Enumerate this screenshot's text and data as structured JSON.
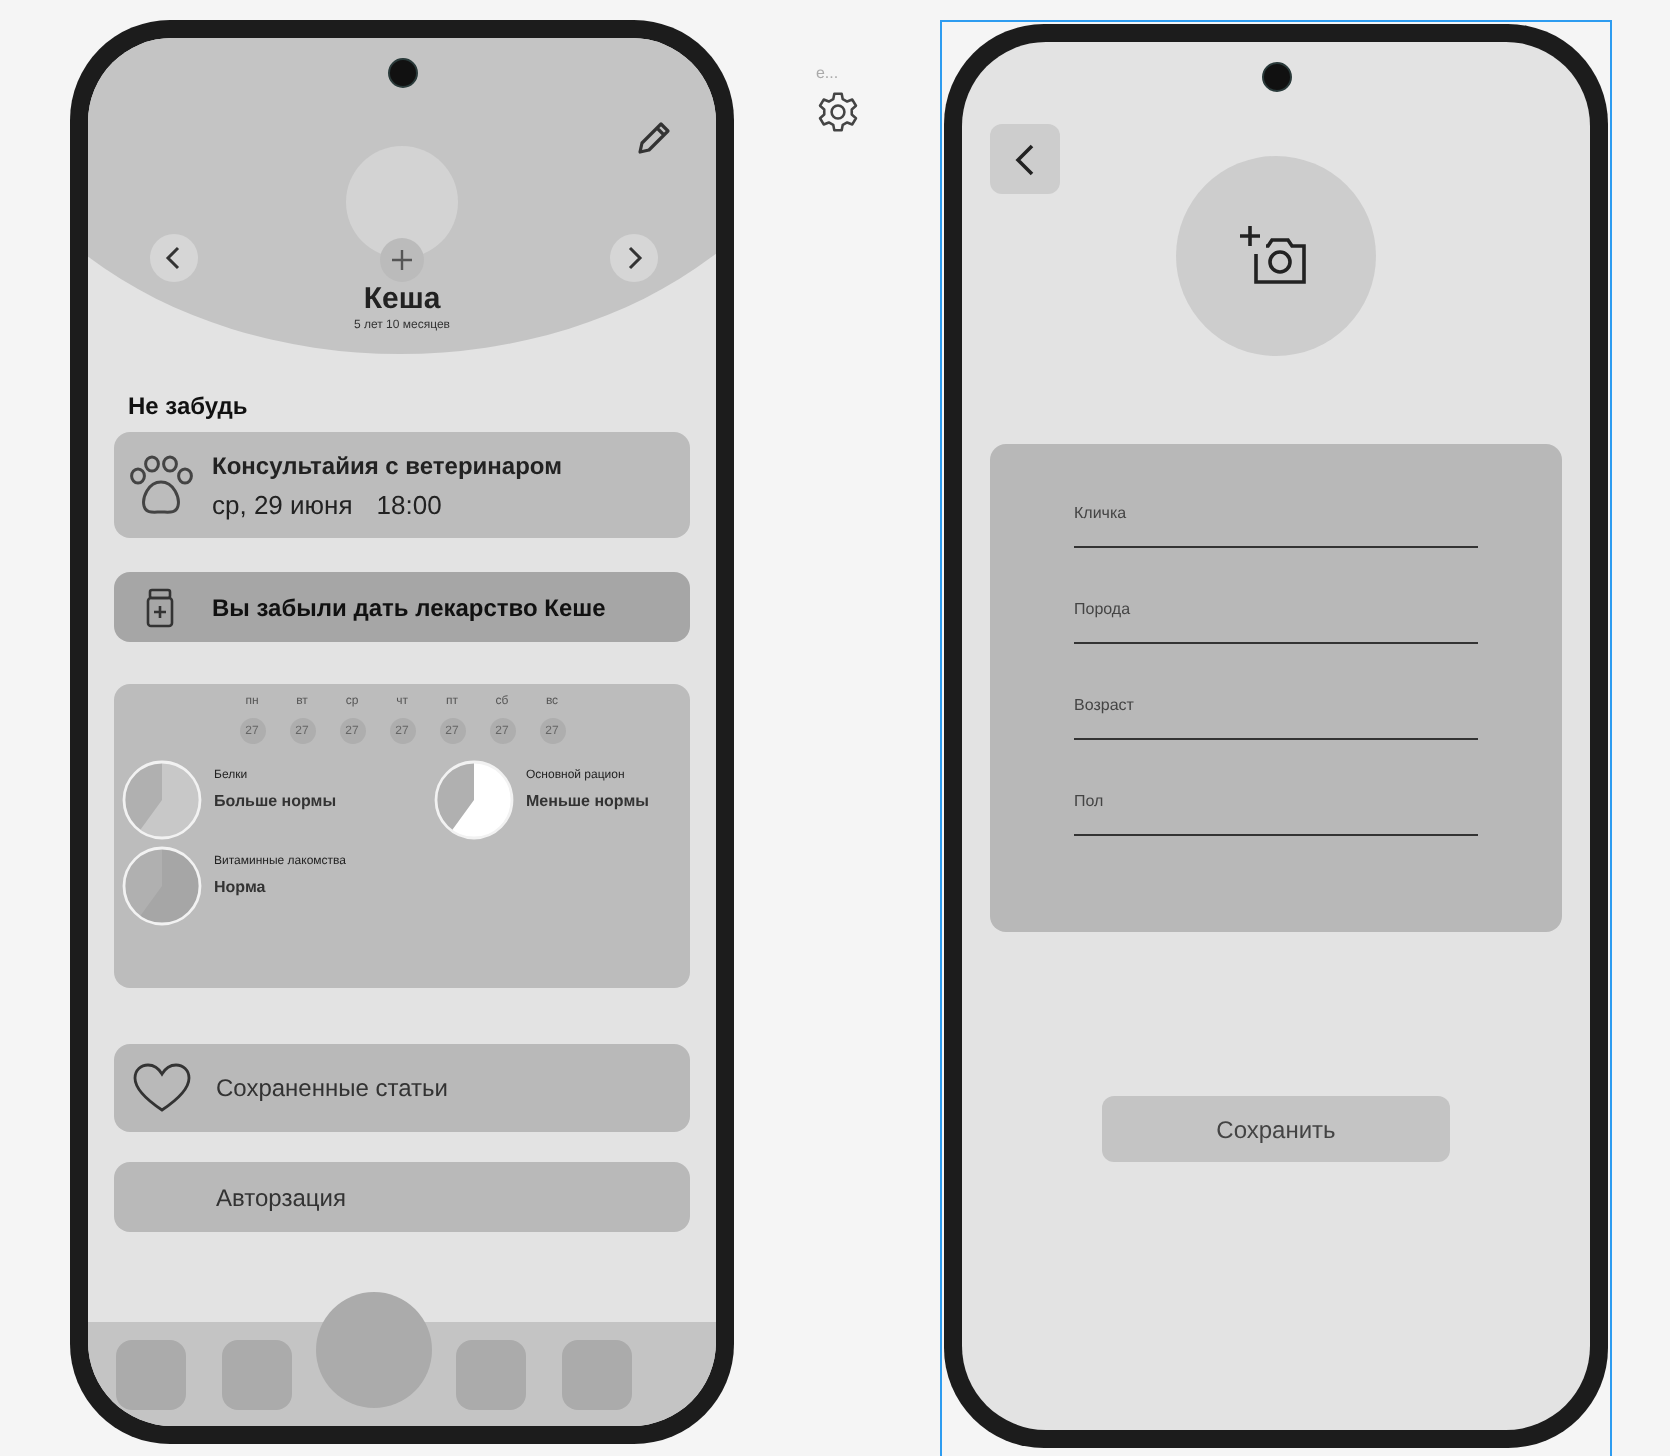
{
  "left_screen": {
    "pet": {
      "name": "Кеша",
      "age": "5 лет 10 месяцев"
    },
    "reminders_title": "Не забудь",
    "appointment": {
      "title": "Консультайия с ветеринаром",
      "date": "ср, 29 июня",
      "time": "18:00"
    },
    "alert": "Вы забыли дать лекарство Кеше",
    "week": [
      {
        "day": "пн",
        "date": "27"
      },
      {
        "day": "вт",
        "date": "27"
      },
      {
        "day": "ср",
        "date": "27"
      },
      {
        "day": "чт",
        "date": "27"
      },
      {
        "day": "пт",
        "date": "27"
      },
      {
        "day": "сб",
        "date": "27"
      },
      {
        "day": "вс",
        "date": "27"
      }
    ],
    "nutrients": [
      {
        "name": "Белки",
        "status": "Больше нормы",
        "color": "#c8c8c8"
      },
      {
        "name": "Основной рацион",
        "status": "Меньше нормы",
        "color": "#ffffff"
      },
      {
        "name": "Витаминные лакомства",
        "status": "Норма",
        "color": "#a6a6a6"
      }
    ],
    "menu": [
      {
        "label": "Сохраненные статьи",
        "kind": "saved"
      },
      {
        "label": "Авторзация",
        "kind": "plain"
      }
    ]
  },
  "canvas_label": "e...",
  "right_screen": {
    "fields": [
      {
        "label": "Кличка"
      },
      {
        "label": "Порода"
      },
      {
        "label": "Возраст"
      },
      {
        "label": "Пол"
      }
    ],
    "save_button": "Сохранить"
  }
}
